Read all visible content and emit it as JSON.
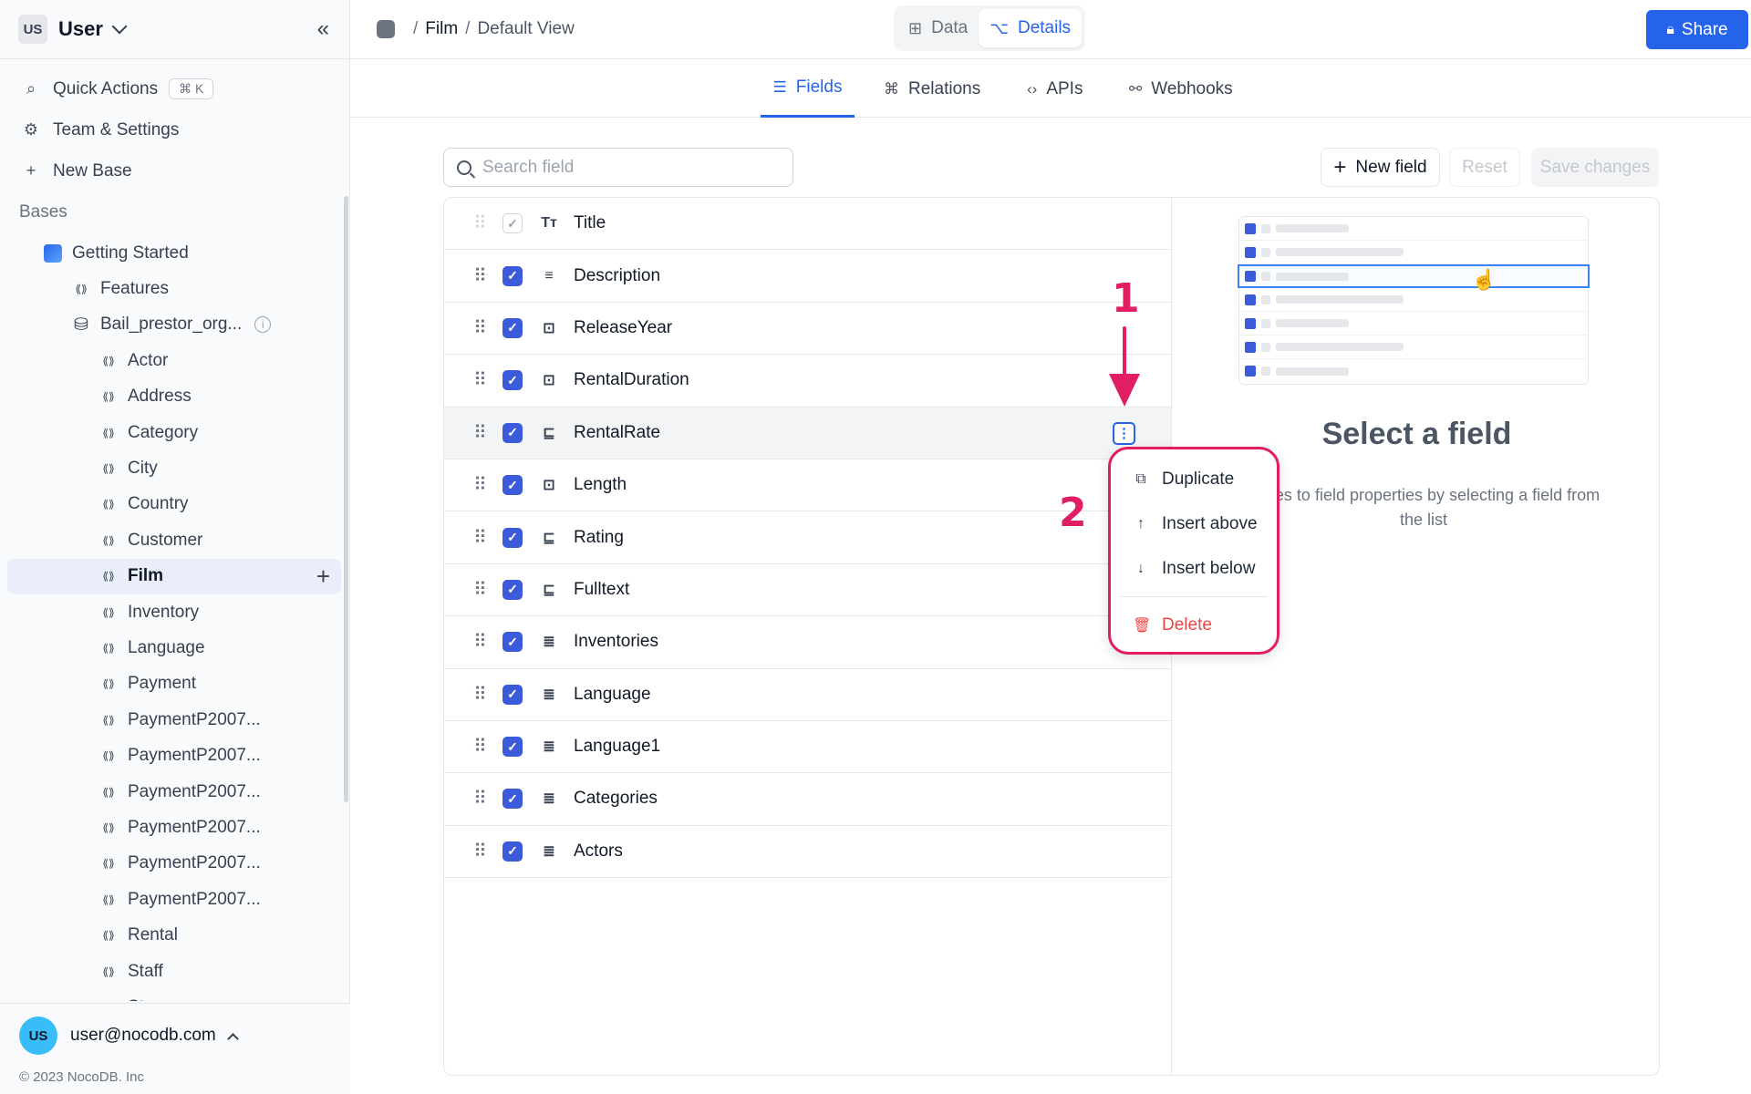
{
  "sidebar": {
    "workspace_initials": "US",
    "workspace_name": "User",
    "actions": [
      {
        "label": "Quick Actions",
        "shortcut": "⌘ K"
      },
      {
        "label": "Team & Settings"
      },
      {
        "label": "New Base"
      }
    ],
    "section_label": "Bases",
    "base_name": "Getting Started",
    "features_label": "Features",
    "source_name": "Bail_prestor_org...",
    "tables": [
      "Actor",
      "Address",
      "Category",
      "City",
      "Country",
      "Customer",
      "Film",
      "Inventory",
      "Language",
      "Payment",
      "PaymentP2007...",
      "PaymentP2007...",
      "PaymentP2007...",
      "PaymentP2007...",
      "PaymentP2007...",
      "PaymentP2007...",
      "Rental",
      "Staff",
      "Store"
    ],
    "active_table": "Film",
    "user_initials": "US",
    "user_email": "user@nocodb.com",
    "copyright": "© 2023 NocoDB. Inc"
  },
  "topbar": {
    "breadcrumb_sep": "/",
    "breadcrumb_table": "Film",
    "breadcrumb_view": "Default View",
    "view_data": "Data",
    "view_details": "Details",
    "share_label": "Share"
  },
  "subtabs": [
    "Fields",
    "Relations",
    "APIs",
    "Webhooks"
  ],
  "toolbar": {
    "search_placeholder": "Search field",
    "new_field": "New field",
    "reset": "Reset",
    "save": "Save changes"
  },
  "fields": [
    {
      "name": "Title",
      "type": "Tт"
    },
    {
      "name": "Description",
      "type": "≡"
    },
    {
      "name": "ReleaseYear",
      "type": "⊡"
    },
    {
      "name": "RentalDuration",
      "type": "⊡"
    },
    {
      "name": "RentalRate",
      "type": "⊑"
    },
    {
      "name": "Length",
      "type": "⊡"
    },
    {
      "name": "Rating",
      "type": "⊑"
    },
    {
      "name": "Fulltext",
      "type": "⊑"
    },
    {
      "name": "Inventories",
      "type": "≣"
    },
    {
      "name": "Language",
      "type": "≣"
    },
    {
      "name": "Language1",
      "type": "≣"
    },
    {
      "name": "Categories",
      "type": "≣"
    },
    {
      "name": "Actors",
      "type": "≣"
    }
  ],
  "detail": {
    "title": "Select a field",
    "subtitle": "anges to field properties by selecting a field from the list"
  },
  "menu": {
    "duplicate": "Duplicate",
    "insert_above": "Insert above",
    "insert_below": "Insert below",
    "delete": "Delete"
  },
  "annotations": {
    "step1": "1",
    "step2": "2"
  },
  "colors": {
    "accent": "#2563eb",
    "annotation": "#e11d63",
    "danger": "#ef4444"
  }
}
